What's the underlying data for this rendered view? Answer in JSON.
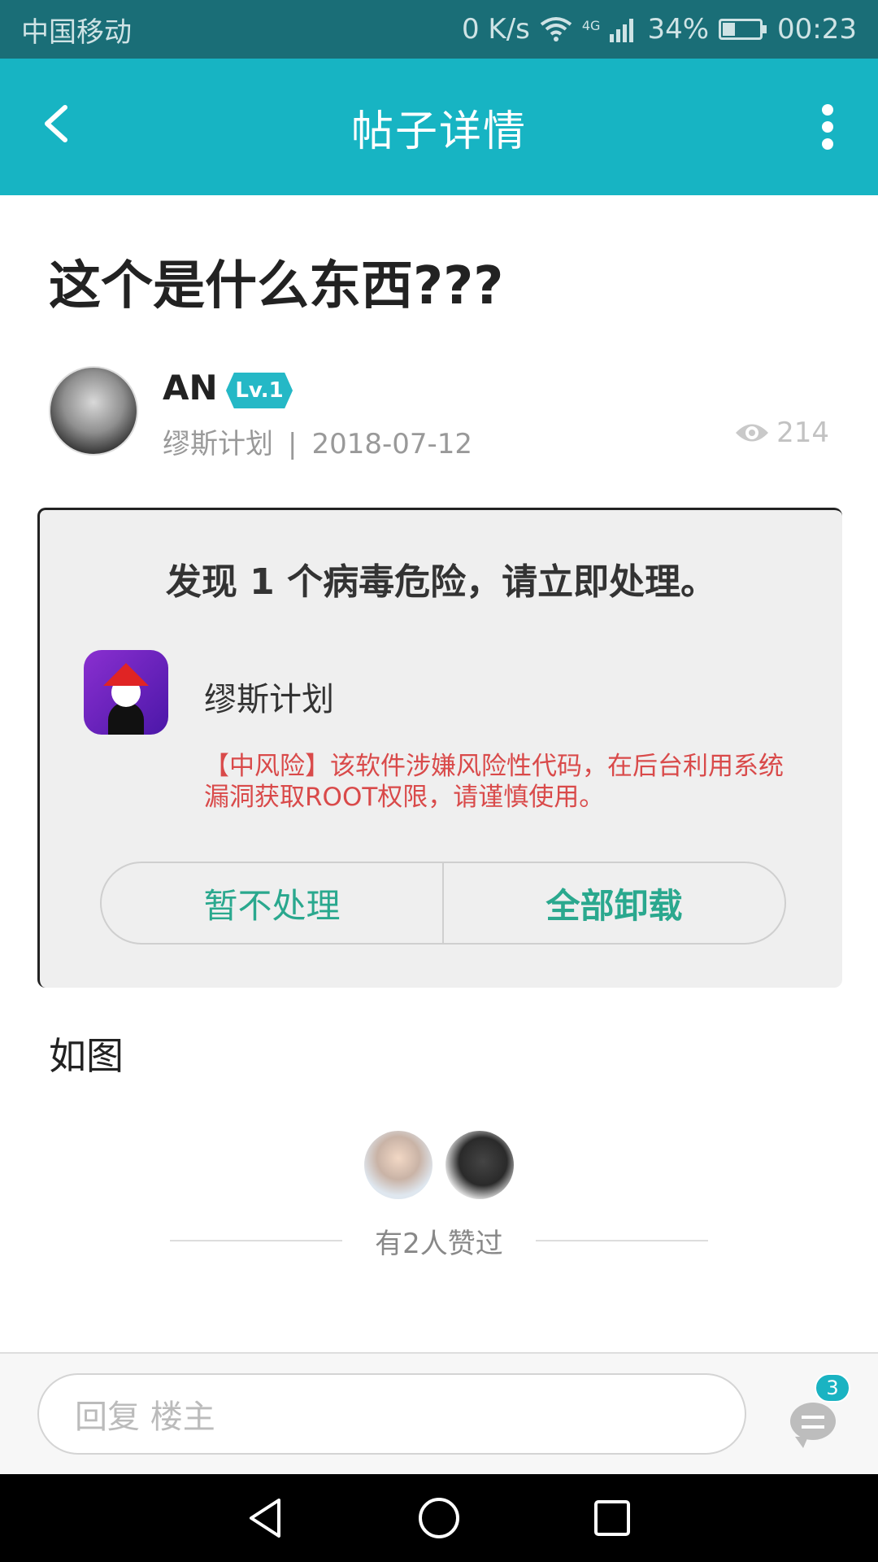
{
  "status_bar": {
    "carrier": "中国移动",
    "net_speed": "0 K/s",
    "network": "4G",
    "battery": "34%",
    "battery_level": 0.34,
    "time": "00:23",
    "icons": [
      "wifi-icon",
      "signal-icon",
      "battery-icon"
    ]
  },
  "header": {
    "title": "帖子详情",
    "icons": [
      "back-icon",
      "more-icon"
    ]
  },
  "post": {
    "title": "这个是什么东西???",
    "author": {
      "name": "AN",
      "level": "Lv.1",
      "section": "缪斯计划",
      "date": "2018-07-12"
    },
    "meta_separator": "|",
    "views": "214",
    "caption": "如图"
  },
  "screenshot": {
    "headline": "发现 1 个病毒危险，请立即处理。",
    "app_name": "缪斯计划",
    "warning": "【中风险】该软件涉嫌风险性代码，在后台利用系统漏洞获取ROOT权限，请谨慎使用。",
    "ignore_label": "暂不处理",
    "uninstall_label": "全部卸载"
  },
  "likes": {
    "text": "有2人赞过",
    "count": 2
  },
  "reply": {
    "placeholder": "回复  楼主",
    "comment_count": "3"
  },
  "nav": {
    "icons": [
      "nav-back-icon",
      "nav-home-icon",
      "nav-recents-icon"
    ]
  },
  "colors": {
    "status_bar": "#1a6e77",
    "header": "#17b4c3",
    "accent": "#25b8c6",
    "warning": "#d94a4a",
    "dialog_button": "#2aa88e"
  }
}
